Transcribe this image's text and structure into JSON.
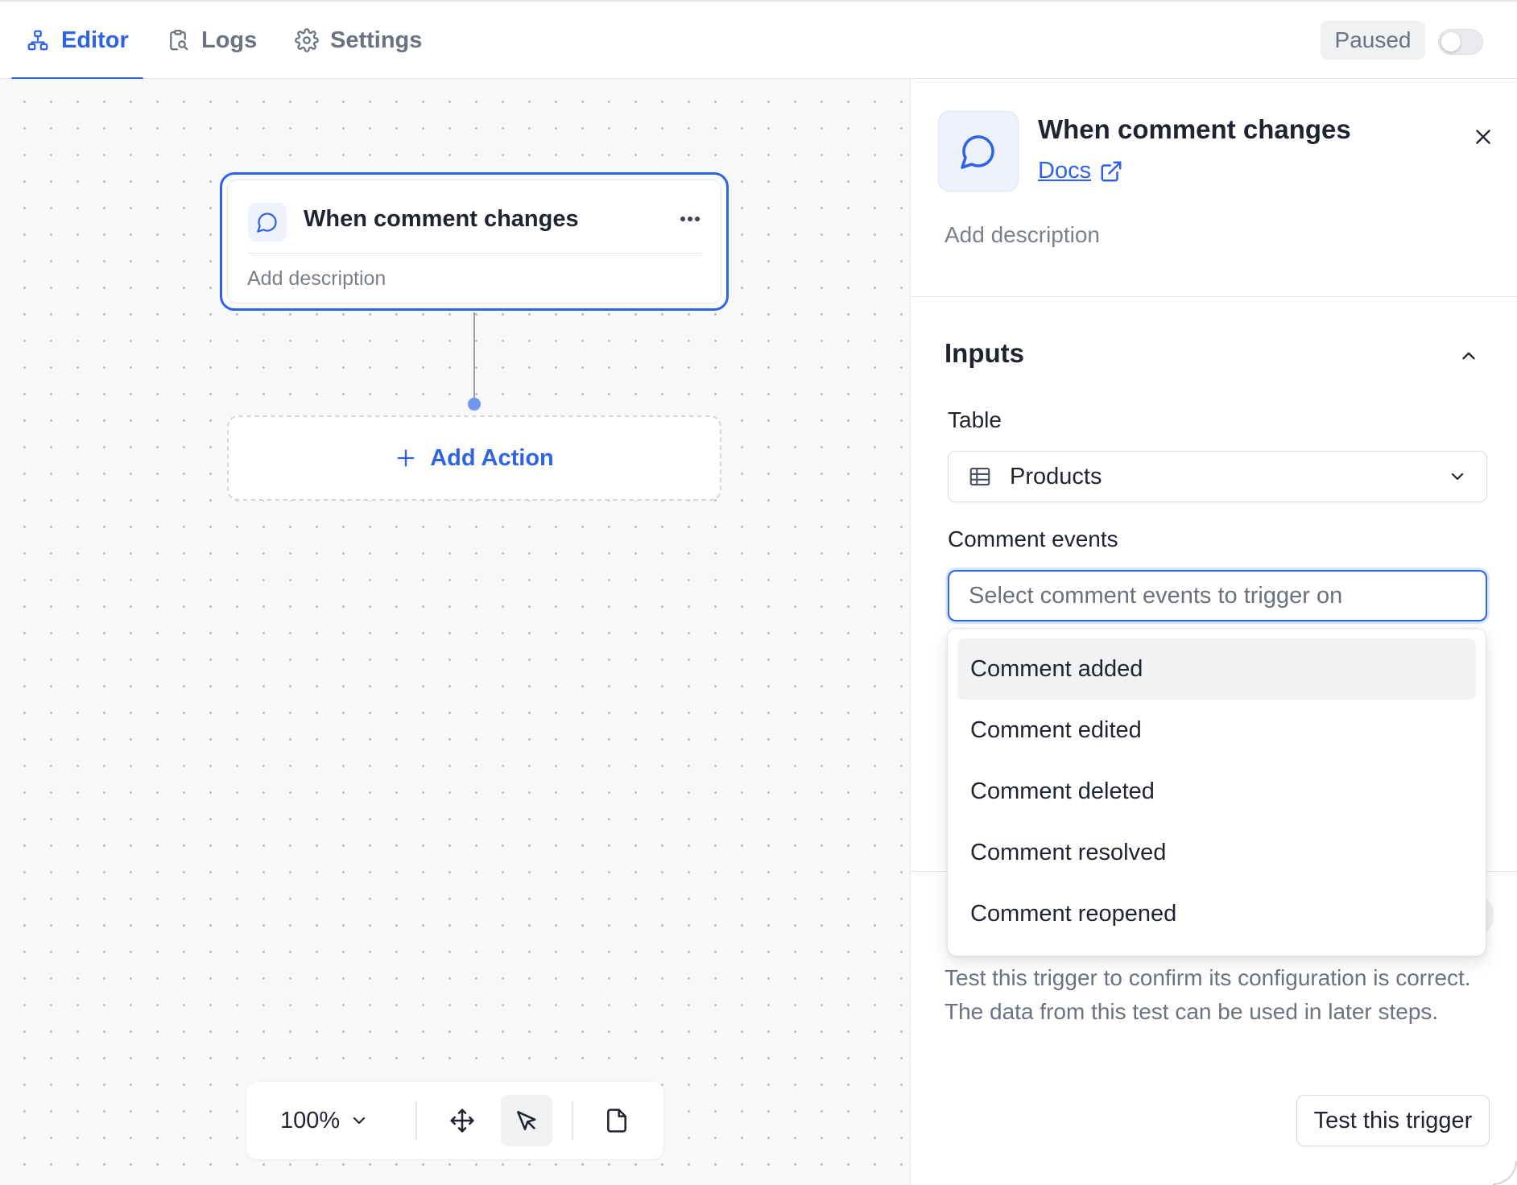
{
  "tabs": [
    {
      "label": "Editor",
      "icon": "workflow-icon",
      "active": true
    },
    {
      "label": "Logs",
      "icon": "clipboard-search-icon",
      "active": false
    },
    {
      "label": "Settings",
      "icon": "gear-icon",
      "active": false
    }
  ],
  "status": {
    "label": "Paused",
    "enabled": false
  },
  "canvas": {
    "trigger_card": {
      "title": "When comment changes",
      "description": "Add description",
      "icon": "comment-icon"
    },
    "add_action_label": "Add Action",
    "zoom_level": "100%"
  },
  "panel": {
    "title": "When comment changes",
    "docs_label": "Docs",
    "description_placeholder": "Add description",
    "inputs_section": {
      "title": "Inputs",
      "table_label": "Table",
      "table_value": "Products",
      "events_label": "Comment events",
      "events_placeholder": "Select comment events to trigger on"
    },
    "test": {
      "description": "Test this trigger to confirm its configuration is correct. The data from this test can be used in later steps.",
      "button_label": "Test this trigger"
    }
  },
  "dropdown": {
    "options": [
      "Comment added",
      "Comment edited",
      "Comment deleted",
      "Comment resolved",
      "Comment reopened"
    ],
    "highlighted_index": 0
  },
  "colors": {
    "accent": "#2f63e6",
    "accent_light": "#eef2fd",
    "muted_text": "#6b7280",
    "canvas_bg": "#f8f8f8"
  }
}
